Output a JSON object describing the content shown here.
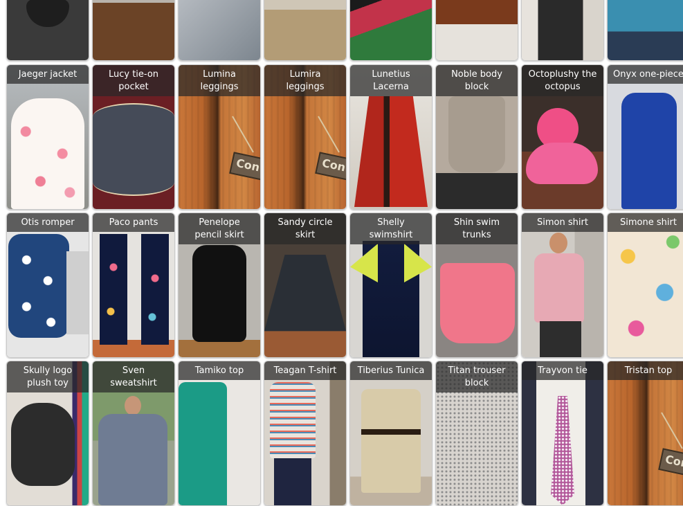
{
  "products": [
    {
      "id": "r0c0",
      "name": ""
    },
    {
      "id": "r0c1",
      "name": ""
    },
    {
      "id": "r0c2",
      "name": ""
    },
    {
      "id": "r0c3",
      "name": ""
    },
    {
      "id": "r0c4",
      "name": ""
    },
    {
      "id": "r0c5",
      "name": ""
    },
    {
      "id": "r0c6",
      "name": ""
    },
    {
      "id": "r0c7",
      "name": ""
    },
    {
      "id": "r1c0",
      "name": "Jaeger jacket"
    },
    {
      "id": "r1c1",
      "name": "Lucy tie-on\npocket"
    },
    {
      "id": "r1c2",
      "name": "Lumina\nleggings"
    },
    {
      "id": "r1c3",
      "name": "Lumira\nleggings"
    },
    {
      "id": "r1c4",
      "name": "Lunetius\nLacerna"
    },
    {
      "id": "r1c5",
      "name": "Noble body\nblock"
    },
    {
      "id": "r1c6",
      "name": "Octoplushy the\noctopus"
    },
    {
      "id": "r1c7",
      "name": "Onyx one-piece"
    },
    {
      "id": "r2c0",
      "name": "Otis romper"
    },
    {
      "id": "r2c1",
      "name": "Paco pants"
    },
    {
      "id": "r2c2",
      "name": "Penelope\npencil skirt"
    },
    {
      "id": "r2c3",
      "name": "Sandy circle\nskirt"
    },
    {
      "id": "r2c4",
      "name": "Shelly\nswimshirt"
    },
    {
      "id": "r2c5",
      "name": "Shin swim\ntrunks"
    },
    {
      "id": "r2c6",
      "name": "Simon shirt"
    },
    {
      "id": "r2c7",
      "name": "Simone shirt"
    },
    {
      "id": "r3c0",
      "name": "Skully logo\nplush toy"
    },
    {
      "id": "r3c1",
      "name": "Sven\nsweatshirt"
    },
    {
      "id": "r3c2",
      "name": "Tamiko top"
    },
    {
      "id": "r3c3",
      "name": "Teagan T-shirt"
    },
    {
      "id": "r3c4",
      "name": "Tiberius Tunica"
    },
    {
      "id": "r3c5",
      "name": "Titan trouser\nblock"
    },
    {
      "id": "r3c6",
      "name": "Trayvon tie"
    },
    {
      "id": "r3c7",
      "name": "Tristan top"
    }
  ],
  "sign_text": "Con"
}
